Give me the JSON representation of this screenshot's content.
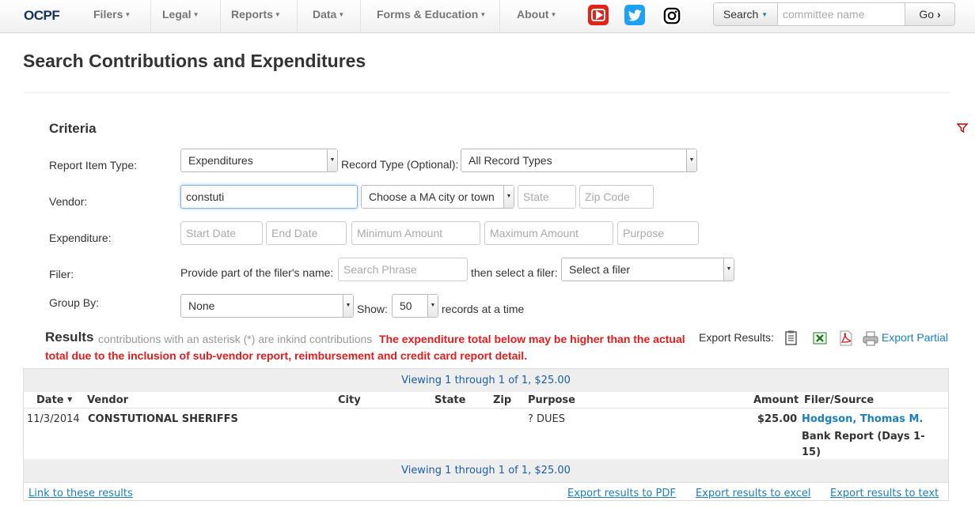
{
  "nav": {
    "logo": "OCPF",
    "items": [
      {
        "label": "Filers"
      },
      {
        "label": "Legal"
      },
      {
        "label": "Reports"
      },
      {
        "label": "Data"
      },
      {
        "label": "Forms & Education"
      },
      {
        "label": "About"
      }
    ],
    "social": [
      {
        "icon": "youtube-icon",
        "color": "#e62117"
      },
      {
        "icon": "twitter-icon",
        "color": "#1da1f2"
      },
      {
        "icon": "instagram-icon",
        "color": "#000000"
      }
    ],
    "search": {
      "button_label": "Search",
      "placeholder": "committee name",
      "go_label": "Go"
    }
  },
  "page": {
    "title": "Search Contributions and Expenditures"
  },
  "criteria": {
    "title": "Criteria",
    "report_item_type": {
      "label": "Report Item Type:",
      "value": "Expenditures"
    },
    "record_type": {
      "label": "Record Type (Optional):",
      "value": "All Record Types"
    },
    "vendor": {
      "label": "Vendor:",
      "value": "constuti",
      "city_value": "Choose a MA city or town",
      "state_placeholder": "State",
      "zip_placeholder": "Zip Code"
    },
    "expenditure": {
      "label": "Expenditure:",
      "start_placeholder": "Start Date",
      "end_placeholder": "End Date",
      "min_placeholder": "Minimum Amount",
      "max_placeholder": "Maximum Amount",
      "purpose_placeholder": "Purpose"
    },
    "filer": {
      "label": "Filer:",
      "prompt": "Provide part of the filer's name:",
      "search_placeholder": "Search Phrase",
      "then_label": "then select a filer:",
      "select_value": "Select a filer"
    },
    "group_by": {
      "label": "Group By:",
      "value": "None",
      "show_label": "Show:",
      "show_value": "50",
      "records_label": "records at a time"
    }
  },
  "results": {
    "title": "Results",
    "note": "contributions with an asterisk (*) are inkind contributions",
    "warning": "The expenditure total below may be higher than the actual total due to the inclusion of sub-vendor report, reimbursement and credit card report detail.",
    "export_label": "Export Results:",
    "export_partial": "Export Partial",
    "pager_text": "Viewing 1 through 1 of 1, $25.00",
    "columns": {
      "date": "Date",
      "vendor": "Vendor",
      "city": "City",
      "state": "State",
      "zip": "Zip",
      "purpose": "Purpose",
      "amount": "Amount",
      "filer": "Filer/Source"
    },
    "rows": [
      {
        "date": "11/3/2014",
        "vendor": "CONSTUTIONAL SHERIFFS",
        "city": "",
        "state": "",
        "zip": "",
        "purpose": "? DUES",
        "amount": "$25.00",
        "filer": "Hodgson, Thomas M.",
        "source": "Bank Report (Days 1-15)"
      }
    ],
    "footer": {
      "link": "Link to these results",
      "pdf": "Export results to PDF",
      "excel": "Export results to excel",
      "text": "Export results to text"
    }
  }
}
